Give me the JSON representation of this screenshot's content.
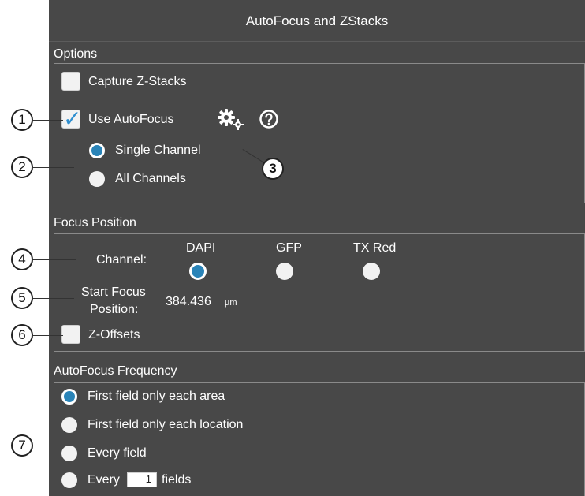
{
  "window": {
    "title": "AutoFocus and ZStacks"
  },
  "options": {
    "section_label": "Options",
    "capture_zstacks": {
      "label": "Capture Z-Stacks",
      "checked": false
    },
    "use_autofocus": {
      "label": "Use AutoFocus",
      "checked": true
    },
    "channel_mode": {
      "selected": "Single Channel",
      "single_label": "Single Channel",
      "all_label": "All Channels"
    },
    "icons": [
      "gears-icon",
      "help-icon"
    ]
  },
  "focus_position": {
    "section_label": "Focus Position",
    "channel_label": "Channel:",
    "channels": [
      "DAPI",
      "GFP",
      "TX Red"
    ],
    "selected_channel": "DAPI",
    "start_label_line1": "Start Focus",
    "start_label_line2": "Position:",
    "start_value": "384.436",
    "start_unit": "µm",
    "zoffsets": {
      "label": "Z-Offsets",
      "checked": false
    }
  },
  "autofocus_frequency": {
    "section_label": "AutoFocus Frequency",
    "options": [
      "First field only each area",
      "First field only each location",
      "Every field"
    ],
    "every_prefix": "Every",
    "every_value": "1",
    "every_suffix": "fields",
    "selected": "First field only each area"
  },
  "callouts": [
    "1",
    "2",
    "3",
    "4",
    "5",
    "6",
    "7"
  ],
  "colors": {
    "panel_bg": "#484848",
    "accent": "#2a84b8",
    "check": "#2f8fd0",
    "border": "#8a8a8a"
  }
}
